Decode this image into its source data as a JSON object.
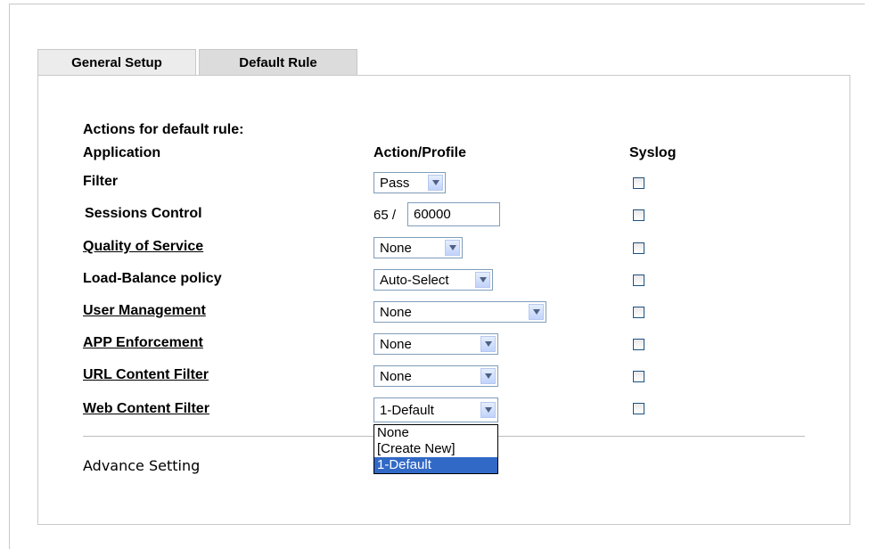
{
  "tabs": [
    {
      "label": "General Setup"
    },
    {
      "label": "Default Rule"
    }
  ],
  "section_title": "Actions for default rule:",
  "headers": {
    "application": "Application",
    "action": "Action/Profile",
    "syslog": "Syslog"
  },
  "rows": [
    {
      "name": "Filter",
      "value": "Pass"
    },
    {
      "name": "Sessions Control",
      "count": "65 /",
      "input": "60000"
    },
    {
      "name": "Quality of Service",
      "value": "None"
    },
    {
      "name": "Load-Balance policy",
      "value": "Auto-Select"
    },
    {
      "name": "User Management",
      "value": "None"
    },
    {
      "name": "APP Enforcement",
      "value": "None"
    },
    {
      "name": "URL Content Filter",
      "value": "None"
    },
    {
      "name": "Web Content Filter",
      "value": "1-Default"
    }
  ],
  "dropdown_options": [
    "None",
    "[Create New]",
    "1-Default"
  ],
  "advance_setting": "Advance Setting"
}
